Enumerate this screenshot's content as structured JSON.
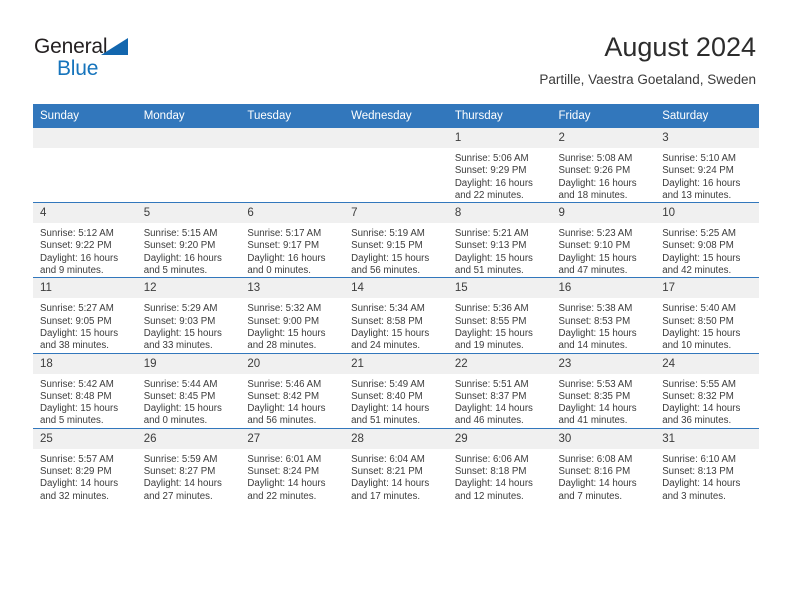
{
  "brand": {
    "name_part1": "General",
    "name_part2": "Blue",
    "triangle_color": "#1266ae",
    "blue_color": "#1674bc"
  },
  "header": {
    "title": "August 2024",
    "subtitle": "Partille, Vaestra Goetaland, Sweden"
  },
  "theme": {
    "header_bg": "#3277bc",
    "daynum_bg": "#f0f0f0",
    "row_divider": "#3277bc",
    "text": "#3c3c3c"
  },
  "weekdays": [
    "Sunday",
    "Monday",
    "Tuesday",
    "Wednesday",
    "Thursday",
    "Friday",
    "Saturday"
  ],
  "weeks": [
    [
      {
        "day": "",
        "lines": []
      },
      {
        "day": "",
        "lines": []
      },
      {
        "day": "",
        "lines": []
      },
      {
        "day": "",
        "lines": []
      },
      {
        "day": "1",
        "lines": [
          "Sunrise: 5:06 AM",
          "Sunset: 9:29 PM",
          "Daylight: 16 hours",
          "and 22 minutes."
        ]
      },
      {
        "day": "2",
        "lines": [
          "Sunrise: 5:08 AM",
          "Sunset: 9:26 PM",
          "Daylight: 16 hours",
          "and 18 minutes."
        ]
      },
      {
        "day": "3",
        "lines": [
          "Sunrise: 5:10 AM",
          "Sunset: 9:24 PM",
          "Daylight: 16 hours",
          "and 13 minutes."
        ]
      }
    ],
    [
      {
        "day": "4",
        "lines": [
          "Sunrise: 5:12 AM",
          "Sunset: 9:22 PM",
          "Daylight: 16 hours",
          "and 9 minutes."
        ]
      },
      {
        "day": "5",
        "lines": [
          "Sunrise: 5:15 AM",
          "Sunset: 9:20 PM",
          "Daylight: 16 hours",
          "and 5 minutes."
        ]
      },
      {
        "day": "6",
        "lines": [
          "Sunrise: 5:17 AM",
          "Sunset: 9:17 PM",
          "Daylight: 16 hours",
          "and 0 minutes."
        ]
      },
      {
        "day": "7",
        "lines": [
          "Sunrise: 5:19 AM",
          "Sunset: 9:15 PM",
          "Daylight: 15 hours",
          "and 56 minutes."
        ]
      },
      {
        "day": "8",
        "lines": [
          "Sunrise: 5:21 AM",
          "Sunset: 9:13 PM",
          "Daylight: 15 hours",
          "and 51 minutes."
        ]
      },
      {
        "day": "9",
        "lines": [
          "Sunrise: 5:23 AM",
          "Sunset: 9:10 PM",
          "Daylight: 15 hours",
          "and 47 minutes."
        ]
      },
      {
        "day": "10",
        "lines": [
          "Sunrise: 5:25 AM",
          "Sunset: 9:08 PM",
          "Daylight: 15 hours",
          "and 42 minutes."
        ]
      }
    ],
    [
      {
        "day": "11",
        "lines": [
          "Sunrise: 5:27 AM",
          "Sunset: 9:05 PM",
          "Daylight: 15 hours",
          "and 38 minutes."
        ]
      },
      {
        "day": "12",
        "lines": [
          "Sunrise: 5:29 AM",
          "Sunset: 9:03 PM",
          "Daylight: 15 hours",
          "and 33 minutes."
        ]
      },
      {
        "day": "13",
        "lines": [
          "Sunrise: 5:32 AM",
          "Sunset: 9:00 PM",
          "Daylight: 15 hours",
          "and 28 minutes."
        ]
      },
      {
        "day": "14",
        "lines": [
          "Sunrise: 5:34 AM",
          "Sunset: 8:58 PM",
          "Daylight: 15 hours",
          "and 24 minutes."
        ]
      },
      {
        "day": "15",
        "lines": [
          "Sunrise: 5:36 AM",
          "Sunset: 8:55 PM",
          "Daylight: 15 hours",
          "and 19 minutes."
        ]
      },
      {
        "day": "16",
        "lines": [
          "Sunrise: 5:38 AM",
          "Sunset: 8:53 PM",
          "Daylight: 15 hours",
          "and 14 minutes."
        ]
      },
      {
        "day": "17",
        "lines": [
          "Sunrise: 5:40 AM",
          "Sunset: 8:50 PM",
          "Daylight: 15 hours",
          "and 10 minutes."
        ]
      }
    ],
    [
      {
        "day": "18",
        "lines": [
          "Sunrise: 5:42 AM",
          "Sunset: 8:48 PM",
          "Daylight: 15 hours",
          "and 5 minutes."
        ]
      },
      {
        "day": "19",
        "lines": [
          "Sunrise: 5:44 AM",
          "Sunset: 8:45 PM",
          "Daylight: 15 hours",
          "and 0 minutes."
        ]
      },
      {
        "day": "20",
        "lines": [
          "Sunrise: 5:46 AM",
          "Sunset: 8:42 PM",
          "Daylight: 14 hours",
          "and 56 minutes."
        ]
      },
      {
        "day": "21",
        "lines": [
          "Sunrise: 5:49 AM",
          "Sunset: 8:40 PM",
          "Daylight: 14 hours",
          "and 51 minutes."
        ]
      },
      {
        "day": "22",
        "lines": [
          "Sunrise: 5:51 AM",
          "Sunset: 8:37 PM",
          "Daylight: 14 hours",
          "and 46 minutes."
        ]
      },
      {
        "day": "23",
        "lines": [
          "Sunrise: 5:53 AM",
          "Sunset: 8:35 PM",
          "Daylight: 14 hours",
          "and 41 minutes."
        ]
      },
      {
        "day": "24",
        "lines": [
          "Sunrise: 5:55 AM",
          "Sunset: 8:32 PM",
          "Daylight: 14 hours",
          "and 36 minutes."
        ]
      }
    ],
    [
      {
        "day": "25",
        "lines": [
          "Sunrise: 5:57 AM",
          "Sunset: 8:29 PM",
          "Daylight: 14 hours",
          "and 32 minutes."
        ]
      },
      {
        "day": "26",
        "lines": [
          "Sunrise: 5:59 AM",
          "Sunset: 8:27 PM",
          "Daylight: 14 hours",
          "and 27 minutes."
        ]
      },
      {
        "day": "27",
        "lines": [
          "Sunrise: 6:01 AM",
          "Sunset: 8:24 PM",
          "Daylight: 14 hours",
          "and 22 minutes."
        ]
      },
      {
        "day": "28",
        "lines": [
          "Sunrise: 6:04 AM",
          "Sunset: 8:21 PM",
          "Daylight: 14 hours",
          "and 17 minutes."
        ]
      },
      {
        "day": "29",
        "lines": [
          "Sunrise: 6:06 AM",
          "Sunset: 8:18 PM",
          "Daylight: 14 hours",
          "and 12 minutes."
        ]
      },
      {
        "day": "30",
        "lines": [
          "Sunrise: 6:08 AM",
          "Sunset: 8:16 PM",
          "Daylight: 14 hours",
          "and 7 minutes."
        ]
      },
      {
        "day": "31",
        "lines": [
          "Sunrise: 6:10 AM",
          "Sunset: 8:13 PM",
          "Daylight: 14 hours",
          "and 3 minutes."
        ]
      }
    ]
  ]
}
